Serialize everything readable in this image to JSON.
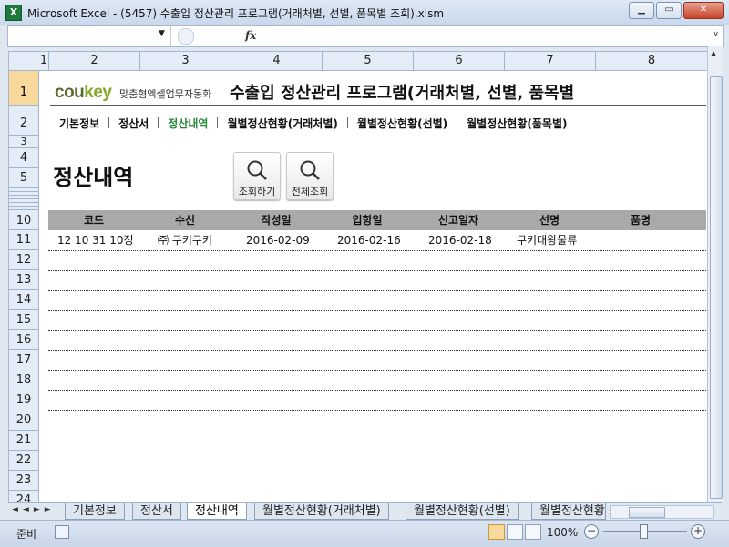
{
  "window": {
    "app_logo": "X",
    "title": "Microsoft Excel - (5457) 수출입 정산관리 프로그램(거래처별, 선별, 품목별 조회).xlsm",
    "min_label": "▁",
    "restore_label": "▭",
    "close_label": "✕"
  },
  "formula_bar": {
    "name_box": "",
    "fx_label": "fx",
    "formula": ""
  },
  "columns": [
    "1",
    "2",
    "3",
    "4",
    "5",
    "6",
    "7",
    "8"
  ],
  "rows": [
    "1",
    "2",
    "3",
    "4",
    "5",
    "10",
    "11",
    "12",
    "13",
    "14",
    "15",
    "16",
    "17",
    "18",
    "19",
    "20",
    "21",
    "22",
    "23",
    "24"
  ],
  "selected_row": "1",
  "brand": {
    "logo_a": "cou",
    "logo_b": "key",
    "tagline": "맞춤형엑셀업무자동화"
  },
  "main_title": "수출입 정산관리 프로그램(거래처별, 선별, 품목별",
  "nav": {
    "items": [
      {
        "label": "기본정보",
        "active": false
      },
      {
        "label": "정산서",
        "active": false
      },
      {
        "label": "정산내역",
        "active": true
      },
      {
        "label": "월별정산현황(거래처별)",
        "active": false
      },
      {
        "label": "월별정산현황(선별)",
        "active": false
      },
      {
        "label": "월별정산현황(품목별)",
        "active": false
      }
    ]
  },
  "page_title": "정산내역",
  "buttons": {
    "search": "조회하기",
    "search_all": "전체조회"
  },
  "table": {
    "headers": [
      "코드",
      "수신",
      "작성일",
      "입항일",
      "신고일자",
      "선명",
      "품명"
    ],
    "rows": [
      [
        "12 10 31 10정",
        "㈜ 쿠키쿠키",
        "2016-02-09",
        "2016-02-16",
        "2016-02-18",
        "쿠키대왕물류",
        ""
      ]
    ]
  },
  "sheet_tabs": [
    {
      "label": "기본정보",
      "active": false
    },
    {
      "label": "정산서",
      "active": false
    },
    {
      "label": "정산내역",
      "active": true
    },
    {
      "label": "월별정산현황(거래처별)",
      "active": false
    },
    {
      "label": "월별정산현황(선별)",
      "active": false
    },
    {
      "label": "월별정산현황",
      "active": false
    }
  ],
  "status": {
    "ready": "준비",
    "zoom": "100%",
    "zoom_out": "−",
    "zoom_in": "+"
  },
  "colors": {
    "active_nav": "#2a8a3c",
    "header_bg": "#a9a9a9",
    "selected_row_header": "#f9d99b"
  }
}
